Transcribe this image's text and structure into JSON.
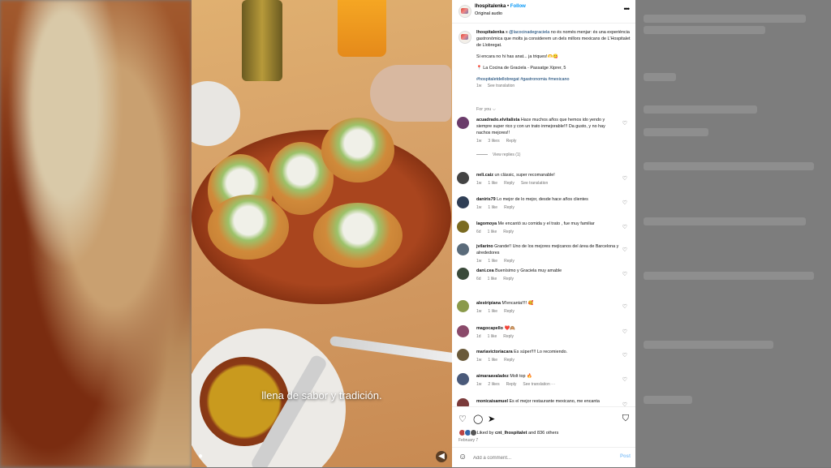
{
  "post": {
    "username": "lhospitalenka",
    "follow_label": "Follow",
    "audio": "Original audio",
    "more_icon": "more-horizontal-icon",
    "caption": {
      "author": "lhospitalenka",
      "mention_prefix": "x",
      "mention": "@lacocinadegraciela",
      "text_main": "no és només menjar: és una experiència gastronòmica que molts ja considerem un dels millors mexicans de L'Hospitalet de Llobregat.",
      "text_line2": "Si encara no hi has anat... ja triques!🫶😋",
      "location": "📍 La Cocina de Graciela - Passatge Xiprer, 5",
      "hashtags": "#hospitaletdellobregat #gastronomia #mexicano",
      "age": "1w",
      "see_translation": "See translation"
    },
    "for_you": "For you ⌵"
  },
  "video": {
    "caption": "llena de sabor y tradición.",
    "mute_icon": "speaker-icon",
    "user_icon": "person-icon"
  },
  "comments": [
    {
      "user": "acuadrado.elvitalista",
      "text": "Hace muchos años que hemos ido yendo y siempre super rico y con un trato inmejorable!!! Da gusto, y no hay nachos mejores!!",
      "age": "1w",
      "likes": "3 likes",
      "reply": "Reply",
      "translate": "",
      "view_replies": "View replies (1)",
      "color": "#6b3c6b"
    },
    {
      "user": "neli.caiz",
      "text": "un clàssic, super recomanable!",
      "age": "1w",
      "likes": "1 like",
      "reply": "Reply",
      "translate": "See translation",
      "view_replies": "",
      "color": "#444"
    },
    {
      "user": "daniris79",
      "text": "Lo mejor de lo mejor, desde hace años clientes",
      "age": "1w",
      "likes": "1 like",
      "reply": "Reply",
      "translate": "",
      "view_replies": "",
      "color": "#2f3e55"
    },
    {
      "user": "lagomoya",
      "text": "Me encantó su comida y el trato , fue muy familiar",
      "age": "6d",
      "likes": "1 like",
      "reply": "Reply",
      "translate": "",
      "view_replies": "",
      "color": "#7a6a20"
    },
    {
      "user": "jvilarino",
      "text": "Grande!! Uno de los mejores mejicanos del área de Barcelona y alrededores",
      "age": "1w",
      "likes": "1 like",
      "reply": "Reply",
      "translate": "",
      "view_replies": "",
      "color": "#5a6b7a"
    },
    {
      "user": "dani.cea",
      "text": "Buenísimo y Graciela muy amable",
      "age": "6d",
      "likes": "1 like",
      "reply": "Reply",
      "translate": "",
      "view_replies": "",
      "color": "#3a4a3a"
    },
    {
      "user": "alestripiana",
      "text": "M'encanta!!!! 🥰",
      "age": "1w",
      "likes": "1 like",
      "reply": "Reply",
      "translate": "",
      "view_replies": "",
      "color": "#8a9a4a"
    },
    {
      "user": "magocapello",
      "text": "❤️🙈",
      "age": "1d",
      "likes": "1 like",
      "reply": "Reply",
      "translate": "",
      "view_replies": "",
      "color": "#8a4a6a"
    },
    {
      "user": "mariavictoriacara",
      "text": "Es súper!!!! Lo recomiendo.",
      "age": "1w",
      "likes": "1 like",
      "reply": "Reply",
      "translate": "",
      "view_replies": "",
      "color": "#6a5a3a"
    },
    {
      "user": "aimaraavaladez",
      "text": "Molt top 🔥",
      "age": "1w",
      "likes": "2 likes",
      "reply": "Reply",
      "translate": "See translation  ···",
      "view_replies": "",
      "color": "#4a5a7a"
    },
    {
      "user": "monicaisamuel",
      "text": "Es el mejor restaurante mexicano, me encanta",
      "age": "",
      "likes": "",
      "reply": "",
      "translate": "",
      "view_replies": "",
      "color": "#7a3a3a"
    }
  ],
  "actions": {
    "like_icon": "heart-icon",
    "comment_icon": "comment-icon",
    "share_icon": "send-icon",
    "save_icon": "bookmark-icon",
    "liked_by_prefix": "Liked by",
    "liked_by_user": "cnt_lhospitalet",
    "liked_by_suffix": "and 836 others",
    "date": "February 7"
  },
  "composer": {
    "placeholder": "Add a comment...",
    "post_label": "Post",
    "emoji_icon": "smiley-icon"
  }
}
